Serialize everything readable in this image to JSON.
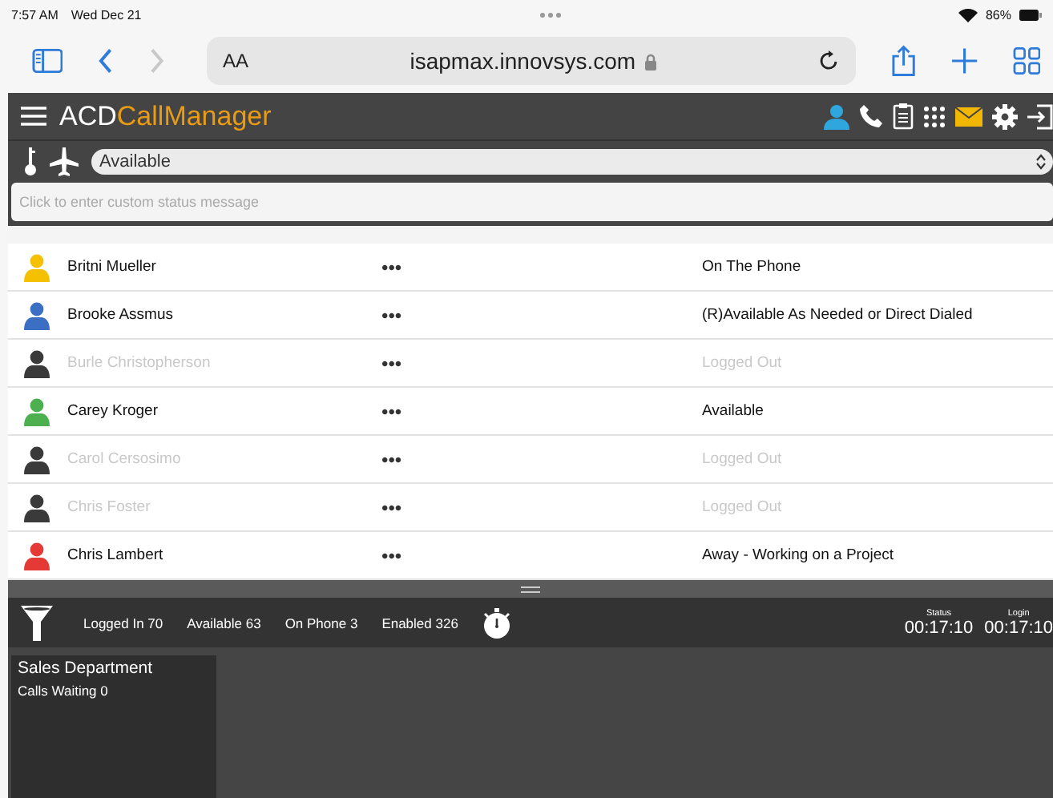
{
  "status_bar": {
    "time": "7:57 AM",
    "date": "Wed Dec 21",
    "battery": "86%"
  },
  "browser": {
    "text_size": "AA",
    "url": "isapmax.innovsys.com"
  },
  "app": {
    "title_part1": "ACD",
    "title_part2": "CallManager"
  },
  "status": {
    "value": "Available",
    "message_placeholder": "Click to enter custom status message"
  },
  "agents": [
    {
      "name": "Britni Mueller",
      "more": "•••",
      "status": "On The Phone",
      "color": "#f5c000",
      "disabled": false
    },
    {
      "name": "Brooke Assmus",
      "more": "•••",
      "status": "(R)Available As Needed or Direct Dialed",
      "color": "#3a6fc4",
      "disabled": false
    },
    {
      "name": "Burle Christopherson",
      "more": "•••",
      "status": "Logged Out",
      "color": "#3a3a3a",
      "disabled": true
    },
    {
      "name": "Carey Kroger",
      "more": "•••",
      "status": "Available",
      "color": "#4caf50",
      "disabled": false
    },
    {
      "name": "Carol Cersosimo",
      "more": "•••",
      "status": "Logged Out",
      "color": "#3a3a3a",
      "disabled": true
    },
    {
      "name": "Chris Foster",
      "more": "•••",
      "status": "Logged Out",
      "color": "#3a3a3a",
      "disabled": true
    },
    {
      "name": "Chris Lambert",
      "more": "•••",
      "status": "Away - Working on a Project",
      "color": "#e53935",
      "disabled": false
    }
  ],
  "stats": [
    "Logged In 70",
    "Available 63",
    "On Phone 3",
    "Enabled 326"
  ],
  "timers": [
    {
      "label": "Status",
      "value": "00:17:10"
    },
    {
      "label": "Login",
      "value": "00:17:10"
    }
  ],
  "queues": [
    {
      "name": "Sales Department",
      "waiting": "Calls Waiting 0"
    }
  ]
}
